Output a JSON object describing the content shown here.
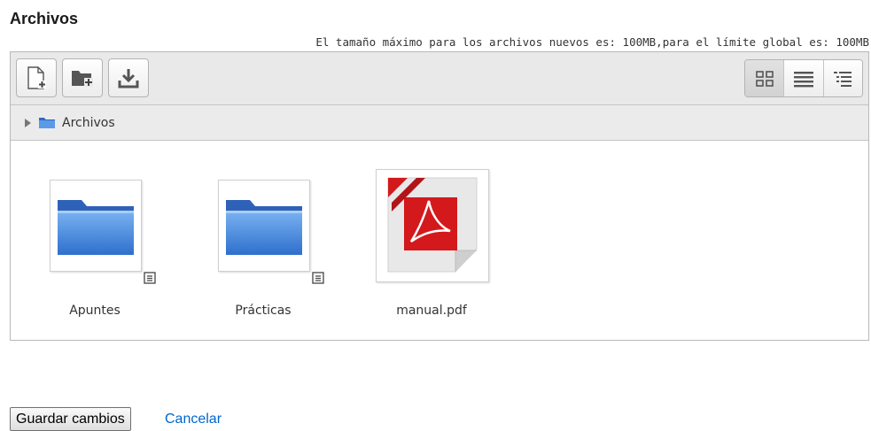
{
  "section": {
    "title": "Archivos"
  },
  "max_size_note": "El tamaño máximo para los archivos nuevos es: 100MB,para el límite global es: 100MB",
  "toolbar": {
    "buttons": [
      {
        "icon": "add-file-icon"
      },
      {
        "icon": "create-folder-icon"
      },
      {
        "icon": "download-icon"
      }
    ],
    "views": [
      {
        "icon": "icons-view-icon",
        "active": true
      },
      {
        "icon": "list-view-icon",
        "active": false
      },
      {
        "icon": "tree-view-icon",
        "active": false
      }
    ]
  },
  "path": {
    "label": "Archivos"
  },
  "files": [
    {
      "name": "Apuntes",
      "type": "folder"
    },
    {
      "name": "Prácticas",
      "type": "folder"
    },
    {
      "name": "manual.pdf",
      "type": "pdf"
    }
  ],
  "actions": {
    "save_label": "Guardar cambios",
    "cancel_label": "Cancelar"
  },
  "colors": {
    "link": "#0066cc",
    "folder": "#3a7fd8",
    "pdf": "#d3191c"
  }
}
